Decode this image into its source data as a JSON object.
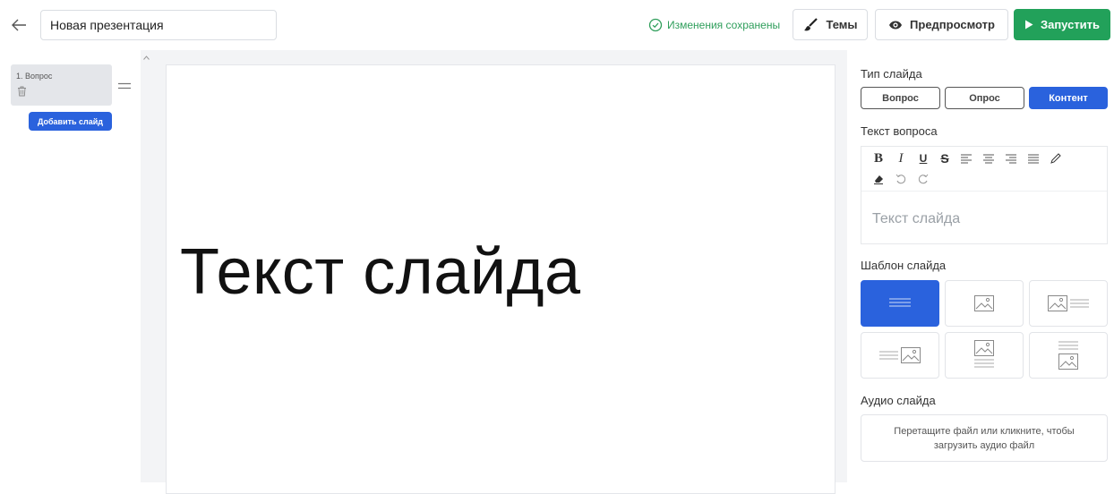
{
  "header": {
    "presentation_title": "Новая презентация",
    "saved_status": "Изменения сохранены",
    "themes_label": "Темы",
    "preview_label": "Предпросмотр",
    "run_label": "Запустить"
  },
  "slides_panel": {
    "slides": [
      {
        "label": "1. Вопрос"
      }
    ],
    "add_slide_label": "Добавить слайд"
  },
  "canvas": {
    "slide_text": "Текст слайда"
  },
  "properties": {
    "slide_type_title": "Тип слайда",
    "slide_types": [
      "Вопрос",
      "Опрос",
      "Контент"
    ],
    "selected_type": "Контент",
    "question_text_title": "Текст вопроса",
    "editor_placeholder": "Текст слайда",
    "template_title": "Шаблон слайда",
    "audio_title": "Аудио слайда",
    "audio_drop_text": "Перетащите файл или кликните, чтобы загрузить аудио файл"
  },
  "colors": {
    "accent_blue": "#2a62dd",
    "run_green": "#22a15a",
    "saved_green": "#2f9e5b"
  },
  "icons": [
    "back-arrow-icon",
    "check-circle-icon",
    "brush-icon",
    "eye-icon",
    "play-icon",
    "trash-icon",
    "drag-handle-icon",
    "bold-icon",
    "italic-icon",
    "underline-icon",
    "strikethrough-icon",
    "align-left-icon",
    "align-center-icon",
    "align-right-icon",
    "align-justify-icon",
    "pen-icon",
    "eraser-icon",
    "undo-icon",
    "redo-icon"
  ]
}
